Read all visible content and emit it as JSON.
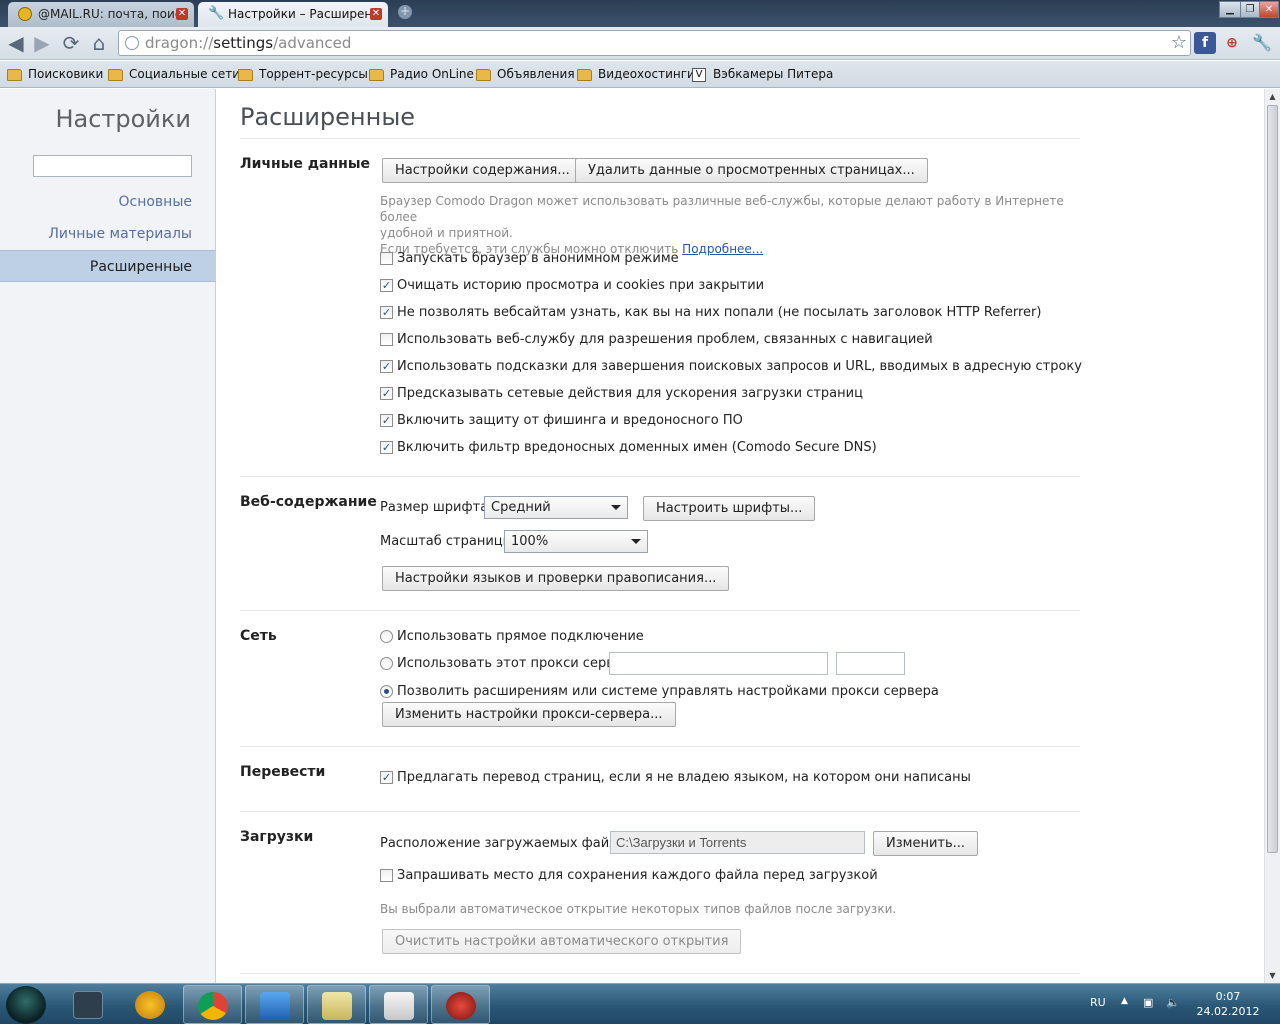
{
  "tabs": [
    {
      "title": "@MAIL.RU: почта, поиск",
      "active": false
    },
    {
      "title": "Настройки – Расширенн",
      "active": true
    }
  ],
  "address": {
    "scheme": "dragon://",
    "host": "settings",
    "path": "/advanced"
  },
  "bookmarks": [
    "Поисковики",
    "Социальные сети",
    "Торрент-ресурсы",
    "Радио OnLine",
    "Объявления",
    "Видеохостинги",
    "Вэбкамеры Питера"
  ],
  "sidebar": {
    "title": "Настройки",
    "search_value": "",
    "items": [
      {
        "label": "Основные",
        "selected": false
      },
      {
        "label": "Личные материалы",
        "selected": false
      },
      {
        "label": "Расширенные",
        "selected": true
      }
    ]
  },
  "page_title": "Расширенные",
  "privacy": {
    "title": "Личные данные",
    "content_settings_button": "Настройки содержания...",
    "clear_data_button": "Удалить данные о просмотренных страницах...",
    "desc_line1": "Браузер Comodo Dragon может использовать различные веб-службы, которые делают работу в Интернете более",
    "desc_line2": "удобной и приятной.",
    "desc_line3": "Если требуется, эти службы можно отключить",
    "learn_more": "Подробнее...",
    "options": [
      {
        "label": "Запускать браузер в анонимном режиме",
        "checked": false
      },
      {
        "label": "Очищать историю просмотра и cookies при закрытии",
        "checked": true
      },
      {
        "label": "Не позволять вебсайтам узнать, как вы на них попали (не посылать заголовок HTTP Referrer)",
        "checked": true
      },
      {
        "label": "Использовать веб-службу для разрешения проблем, связанных с навигацией",
        "checked": false
      },
      {
        "label": "Использовать подсказки для завершения поисковых запросов и URL, вводимых в адресную строку",
        "checked": true
      },
      {
        "label": "Предсказывать сетевые действия для ускорения загрузки страниц",
        "checked": true
      },
      {
        "label": "Включить защиту от фишинга и вредоносного ПО",
        "checked": true
      },
      {
        "label": "Включить фильтр вредоносных доменных имен (Comodo Secure DNS)",
        "checked": true
      }
    ]
  },
  "web_content": {
    "title": "Веб-содержание",
    "font_size_label": "Размер шрифта:",
    "font_size_value": "Средний",
    "customize_fonts_button": "Настроить шрифты...",
    "zoom_label": "Масштаб страницы:",
    "zoom_value": "100%",
    "languages_button": "Настройки языков и проверки правописания..."
  },
  "network": {
    "title": "Сеть",
    "direct": {
      "label": "Использовать прямое подключение",
      "selected": false
    },
    "proxy": {
      "label": "Использовать этот прокси сервер:",
      "selected": false,
      "host": "",
      "port": ""
    },
    "system": {
      "label": "Позволить расширениям или системе управлять настройками прокси сервера",
      "selected": true
    },
    "change_proxy_button": "Изменить настройки прокси-сервера..."
  },
  "translate": {
    "title": "Перевести",
    "option": {
      "label": "Предлагать перевод страниц, если я не владею языком, на котором они написаны",
      "checked": true
    }
  },
  "downloads": {
    "title": "Загрузки",
    "location_label": "Расположение загружаемых файлов:",
    "location_value": "C:\\Загрузки и Torrents",
    "change_button": "Изменить...",
    "ask_option": {
      "label": "Запрашивать место для сохранения каждого файла перед загрузкой",
      "checked": false
    },
    "auto_open_desc": "Вы выбрали автоматическое открытие некоторых типов файлов после загрузки.",
    "reset_auto_open_button": "Очистить настройки автоматического открытия"
  },
  "taskbar": {
    "language": "RU",
    "time": "0:07",
    "date": "24.02.2012"
  },
  "colors": {
    "link": "#2a56a8",
    "sidebar_selected": "#bdd0e6",
    "taskbar": "#2a5775"
  }
}
